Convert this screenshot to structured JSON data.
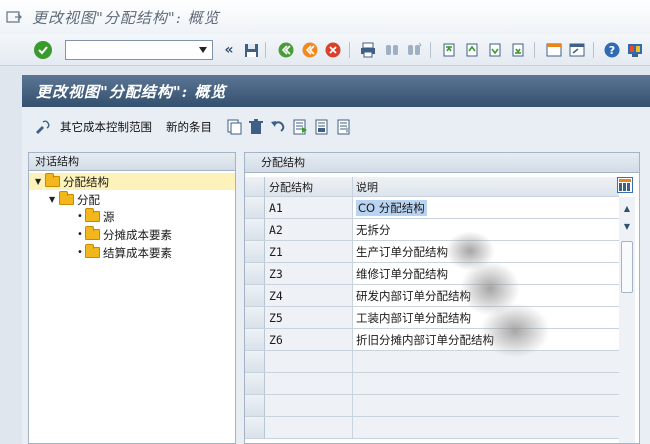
{
  "window": {
    "title": "更改视图\"分配结构\": 概览"
  },
  "toolbar": {
    "command_value": "",
    "icons": [
      "enter-icon",
      "back-icon",
      "save-icon",
      "back-nav-icon",
      "exit-icon",
      "cancel-icon",
      "print-icon",
      "find-icon",
      "find-next-icon",
      "first-page-icon",
      "prev-page-icon",
      "next-page-icon",
      "last-page-icon",
      "new-session-icon",
      "shortcut-icon",
      "help-icon",
      "customize-icon"
    ]
  },
  "screen": {
    "header": "更改视图\"分配结构\": 概览"
  },
  "app_toolbar": {
    "other_range_label": "其它成本控制范围",
    "new_entries_label": "新的条目"
  },
  "tree": {
    "title": "对话结构",
    "nodes": [
      {
        "label": "分配结构",
        "level": 0,
        "expanded": true,
        "selected": true
      },
      {
        "label": "分配",
        "level": 1,
        "expanded": true
      },
      {
        "label": "源",
        "level": 2
      },
      {
        "label": "分摊成本要素",
        "level": 2
      },
      {
        "label": "结算成本要素",
        "level": 2
      }
    ]
  },
  "table": {
    "title": "分配结构",
    "columns": [
      "分配结构",
      "说明"
    ],
    "rows": [
      {
        "code": "A1",
        "desc": "CO 分配结构"
      },
      {
        "code": "A2",
        "desc": "无拆分"
      },
      {
        "code": "Z1",
        "desc": "生产订单分配结构"
      },
      {
        "code": "Z3",
        "desc": "维修订单分配结构"
      },
      {
        "code": "Z4",
        "desc": "研发内部订单分配结构"
      },
      {
        "code": "Z5",
        "desc": "工装内部订单分配结构"
      },
      {
        "code": "Z6",
        "desc": "折旧分摊内部订单分配结构"
      }
    ],
    "empty_rows": 4
  }
}
